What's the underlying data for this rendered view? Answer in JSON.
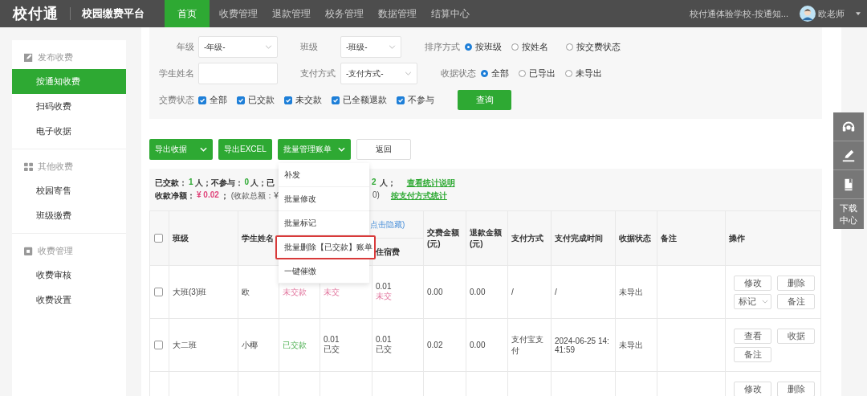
{
  "header": {
    "logo": "校付通",
    "platform": "校园缴费平台",
    "school": "校付通体验学校-按通知...",
    "user": "欧老师"
  },
  "nav": [
    {
      "label": "首页",
      "selected": true
    },
    {
      "label": "收费管理",
      "selected": false
    },
    {
      "label": "退款管理",
      "selected": false
    },
    {
      "label": "校务管理",
      "selected": false
    },
    {
      "label": "数据管理",
      "selected": false
    },
    {
      "label": "结算中心",
      "selected": false
    }
  ],
  "sidebar": {
    "groups": [
      {
        "title": "发布收费",
        "items": [
          {
            "label": "按通知收费",
            "selected": true
          },
          {
            "label": "扫码收费",
            "selected": false
          },
          {
            "label": "电子收据",
            "selected": false
          }
        ]
      },
      {
        "title": "其他收费",
        "items": [
          {
            "label": "校园寄售",
            "selected": false
          },
          {
            "label": "班级缴费",
            "selected": false
          }
        ]
      },
      {
        "title": "收费管理",
        "items": [
          {
            "label": "收费审核",
            "selected": false
          },
          {
            "label": "收费设置",
            "selected": false
          }
        ]
      }
    ]
  },
  "filters": {
    "grade": {
      "label": "年级",
      "value": "-年级-"
    },
    "class": {
      "label": "班级",
      "value": "-班级-"
    },
    "sort": {
      "label": "排序方式",
      "options": [
        {
          "label": "按班级",
          "selected": true
        },
        {
          "label": "按姓名",
          "selected": false
        },
        {
          "label": "按交费状态",
          "selected": false
        }
      ]
    },
    "student_name": {
      "label": "学生姓名"
    },
    "payment_method": {
      "label": "支付方式",
      "value": "-支付方式-"
    },
    "receipt_status": {
      "label": "收据状态",
      "options": [
        {
          "label": "全部",
          "selected": true
        },
        {
          "label": "已导出",
          "selected": false
        },
        {
          "label": "未导出",
          "selected": false
        }
      ]
    },
    "fee_status": {
      "label": "交费状态",
      "options": [
        {
          "label": "全部",
          "checked": true
        },
        {
          "label": "已交款",
          "checked": true
        },
        {
          "label": "未交款",
          "checked": true
        },
        {
          "label": "已全额退款",
          "checked": true
        },
        {
          "label": "不参与",
          "checked": true
        }
      ]
    },
    "query_button": "查询"
  },
  "toolbar": [
    {
      "label": "导出收据",
      "kind": "split"
    },
    {
      "label": "导出EXCEL",
      "kind": "plain"
    },
    {
      "label": "批量管理账单",
      "kind": "caret"
    },
    {
      "label": "返回",
      "kind": "outline"
    }
  ],
  "stats": [
    {
      "left": [
        {
          "text": "已交款：",
          "kind": "label"
        },
        {
          "text": "1",
          "kind": "count"
        },
        {
          "text": "人；",
          "kind": "label"
        },
        {
          "text": "不参与：",
          "kind": "label"
        },
        {
          "text": "0",
          "kind": "count"
        },
        {
          "text": "人；",
          "kind": "label"
        },
        {
          "text": "已",
          "kind": "label"
        }
      ],
      "right": [
        {
          "text": "2",
          "kind": "count"
        },
        {
          "text": "人；",
          "kind": "label"
        },
        {
          "text": "查看统计说明",
          "kind": "link"
        }
      ]
    },
    {
      "left": [
        {
          "text": "收款净额：",
          "kind": "label"
        },
        {
          "text": "¥ 0.02",
          "kind": "amount"
        },
        {
          "text": "；",
          "kind": "label"
        },
        {
          "text": "(收款总额：¥",
          "kind": "note"
        }
      ],
      "right": [
        {
          "text": "0)",
          "kind": "note"
        },
        {
          "text": "按支付方式统计",
          "kind": "link"
        }
      ]
    }
  ],
  "menu": [
    {
      "label": "补发",
      "highlighted": false
    },
    {
      "label": "批量修改",
      "highlighted": false
    },
    {
      "label": "批量标记",
      "highlighted": false
    },
    {
      "label": "批量删除【已交款】账单",
      "highlighted": true
    },
    {
      "label": "一键催缴",
      "highlighted": false
    }
  ],
  "table": {
    "header_checked": false,
    "columns": [
      {
        "label": "班级"
      },
      {
        "label": "学生姓名"
      },
      {},
      {},
      {
        "label": "住宿费"
      },
      {
        "label": "交费金额(元)"
      },
      {
        "label": "退款金额(元)"
      },
      {
        "label": "支付方式"
      },
      {
        "label": "支付完成时间"
      },
      {
        "label": "收据状态"
      },
      {
        "label": "备注"
      },
      {
        "label": "操作"
      }
    ],
    "group_header": "点击隐藏)",
    "rows": [
      {
        "checked": false,
        "class": "大班(3)班",
        "student": "欧",
        "status": {
          "text": "未交款",
          "kind": "unpaid"
        },
        "fees": [
          [
            {
              "text": "未交",
              "kind": "unpaid"
            }
          ],
          [
            {
              "text": "0.01",
              "kind": "plain"
            },
            {
              "text": "未交",
              "kind": "unpaid"
            }
          ]
        ],
        "paid": "0.00",
        "refund": "0.00",
        "method": "/",
        "time": "/",
        "receipt": "未导出",
        "note": "",
        "actions": [
          {
            "label": "修改",
            "kind": "button"
          },
          {
            "label": "删除",
            "kind": "button"
          },
          {
            "label": "标记",
            "kind": "select"
          },
          {
            "label": "备注",
            "kind": "button"
          }
        ]
      },
      {
        "checked": false,
        "class": "大二班",
        "student": "小椰",
        "status": {
          "text": "已交款",
          "kind": "paid"
        },
        "fees": [
          [
            {
              "text": "0.01",
              "kind": "plain"
            },
            {
              "text": "已交",
              "kind": "plain"
            }
          ],
          [
            {
              "text": "0.01",
              "kind": "plain"
            },
            {
              "text": "已交",
              "kind": "plain"
            }
          ]
        ],
        "paid": "0.02",
        "refund": "0.00",
        "method": "支付宝支付",
        "time": "2024-06-25 14:41:59",
        "receipt": "未导出",
        "note": "",
        "actions": [
          {
            "label": "查看",
            "kind": "button"
          },
          {
            "label": "收据",
            "kind": "button"
          },
          {
            "label": "备注",
            "kind": "button"
          }
        ]
      },
      {
        "actions": [
          {
            "label": "修改",
            "kind": "button"
          },
          {
            "label": "删除",
            "kind": "button"
          }
        ]
      }
    ]
  },
  "side_tools": {
    "download": "下载中心"
  }
}
